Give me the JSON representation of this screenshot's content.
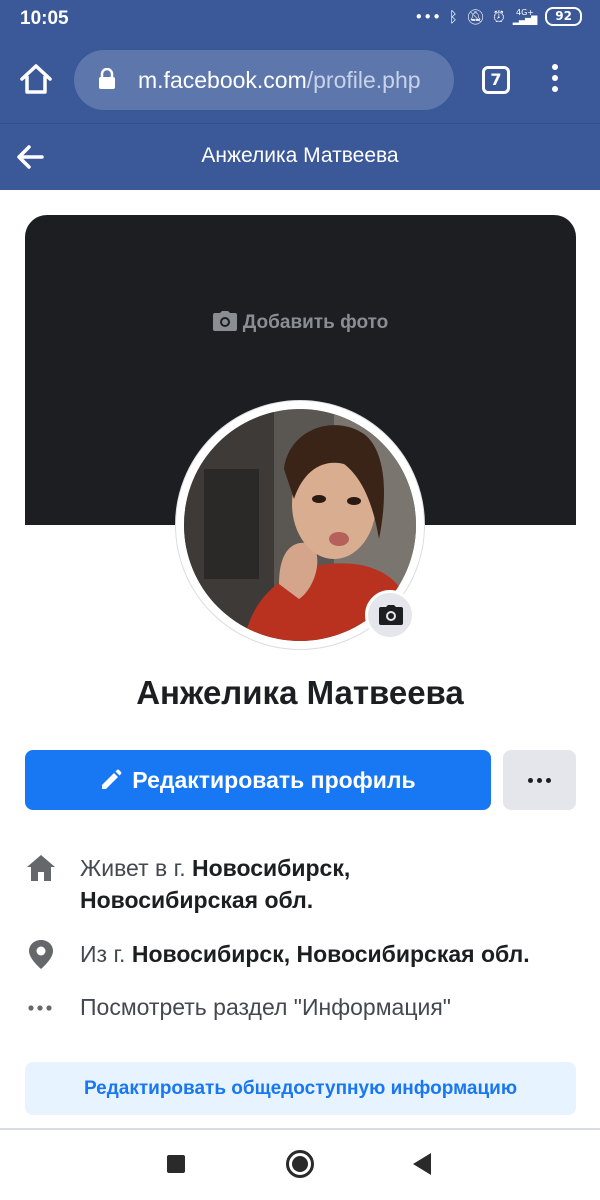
{
  "status_bar": {
    "time": "10:05",
    "network_label": "4G+",
    "battery": "92"
  },
  "browser": {
    "url_main": "m.facebook.com",
    "url_path": "/profile.php",
    "tab_count": "7"
  },
  "header": {
    "title": "Анжелика Матвеева"
  },
  "cover": {
    "add_photo_label": "Добавить фото"
  },
  "profile": {
    "name": "Анжелика Матвеева",
    "edit_button_label": "Редактировать профиль"
  },
  "info": {
    "lives_prefix": "Живет в г.",
    "lives_city": "Новосибирск,",
    "lives_region": "Новосибирская обл.",
    "from_prefix": "Из г.",
    "from_place": "Новосибирск, Новосибирская обл.",
    "see_about": "Посмотреть раздел \"Информация\""
  },
  "public_info_button": "Редактировать общедоступную информацию",
  "colors": {
    "facebook_blue": "#3b5998",
    "primary_button": "#1877f2",
    "cover_bg": "#1c1e22"
  },
  "icons": {
    "home": "home-icon",
    "lock": "lock-icon",
    "back": "arrow-left-icon",
    "camera": "camera-icon",
    "pencil": "pencil-icon",
    "house": "house-icon",
    "location": "location-pin-icon",
    "more": "more-horizontal-icon"
  }
}
